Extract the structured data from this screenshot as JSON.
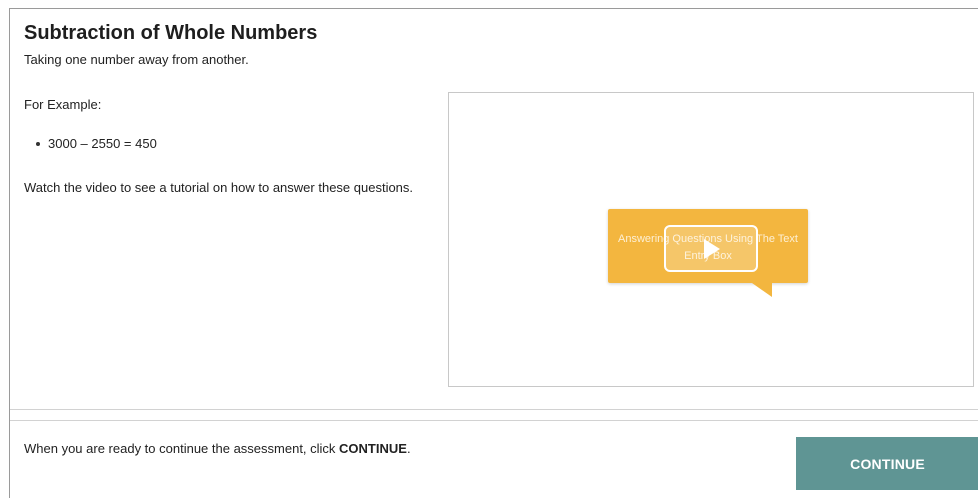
{
  "lesson": {
    "title": "Subtraction of Whole Numbers",
    "subtitle": "Taking one number away from another.",
    "example_label": "For Example:",
    "examples": [
      "3000 – 2550 = 450"
    ],
    "instructions": "Watch the video to see a tutorial on how to answer these questions."
  },
  "video": {
    "thumbnail_title": "Answering Questions Using The Text Entry Box",
    "thumbnail_color": "#f3b63f",
    "play_icon": "play-icon"
  },
  "footer": {
    "prompt_prefix": "When you are ready to continue the assessment, click ",
    "prompt_bold": "CONTINUE",
    "prompt_suffix": ".",
    "continue_label": "CONTINUE",
    "button_color": "#5f9594"
  }
}
